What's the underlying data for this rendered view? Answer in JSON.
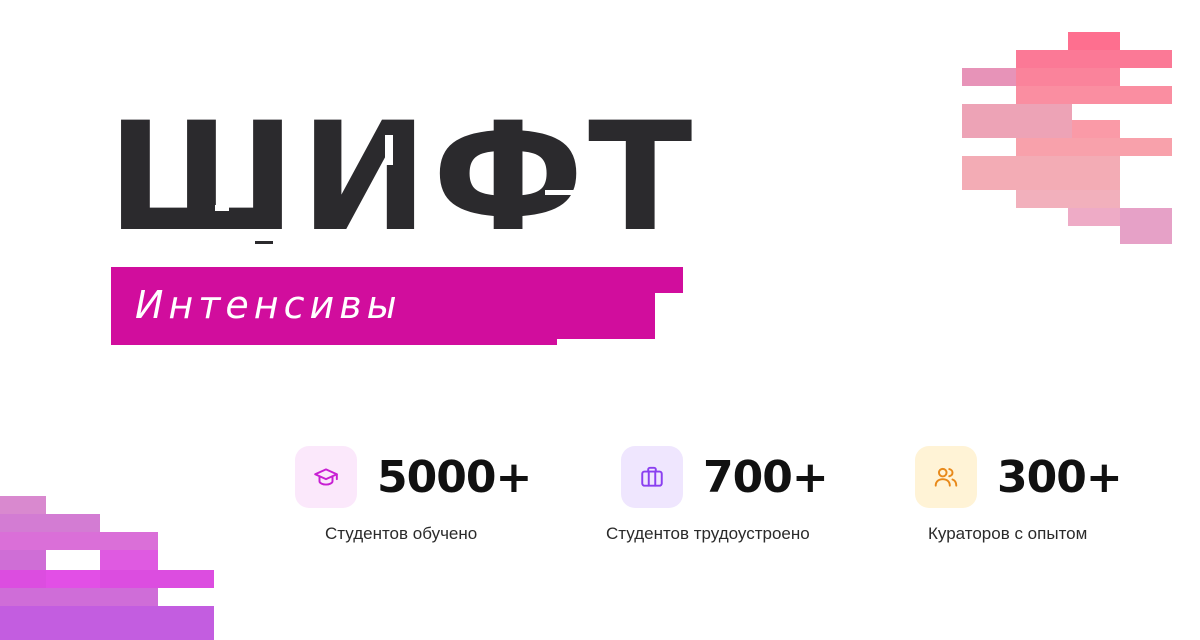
{
  "logo": {
    "title": "ШИФТ",
    "subtitle": "Интенсивы"
  },
  "stats": [
    {
      "value": "5000+",
      "label": "Студентов обучено",
      "icon": "graduation-cap-icon",
      "icon_bg": "#fbe8fb",
      "icon_color": "#c81fd3"
    },
    {
      "value": "700+",
      "label": "Студентов трудоустроено",
      "icon": "briefcase-icon",
      "icon_bg": "#efe6fe",
      "icon_color": "#8a3ff0"
    },
    {
      "value": "300+",
      "label": "Кураторов с опытом",
      "icon": "users-icon",
      "icon_bg": "#fff3d6",
      "icon_color": "#e8891a"
    }
  ],
  "colors": {
    "logo_dark": "#2b2a2d",
    "accent_magenta": "#d10d9d"
  }
}
